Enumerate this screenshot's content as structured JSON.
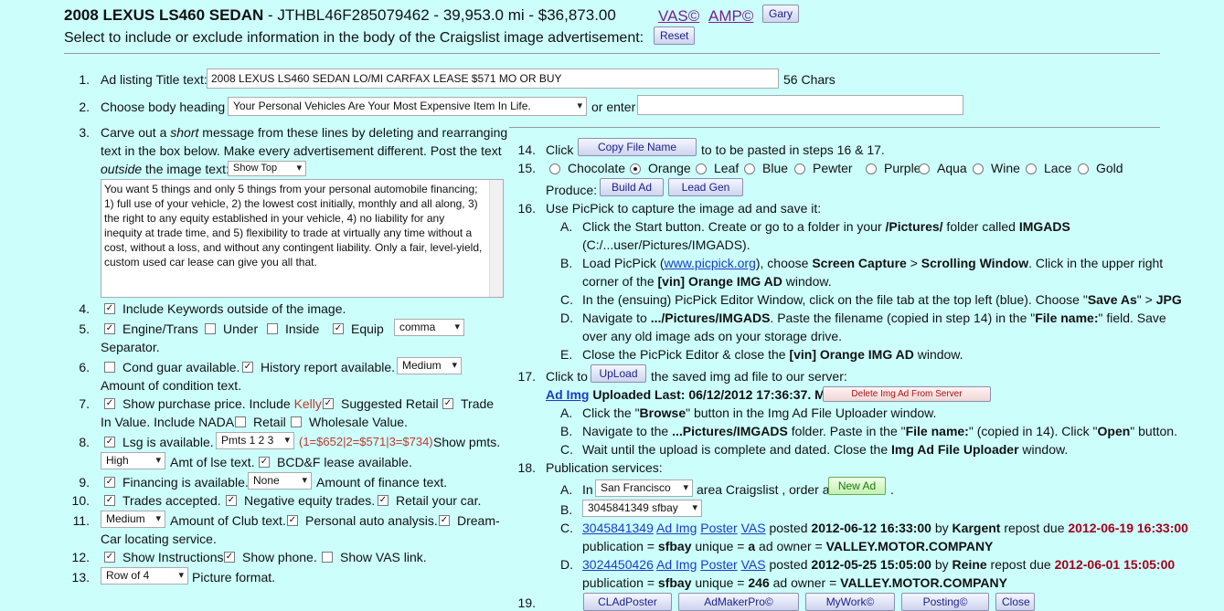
{
  "header": {
    "title_bold": "2008 LEXUS LS460 SEDAN",
    "title_rest": " - JTHBL46F285079462 - 39,953.0 mi - $36,873.00",
    "vas_link": "VAS©",
    "amp_link": "AMP©",
    "user_button": "Gary",
    "subtitle": "Select to include or exclude information in the body of the Craigslist image advertisement:",
    "reset_button": "Reset"
  },
  "step1": {
    "num": "1.",
    "label": "Ad listing Title text:",
    "value": "2008 LEXUS LS460 SEDAN LO/MI CARFAX LEASE $571 MO OR BUY",
    "chars": "56 Chars"
  },
  "step2": {
    "num": "2.",
    "label": "Choose body heading",
    "selected": "Your Personal Vehicles Are Your Most Expensive Item In Life.",
    "or_enter": "or enter",
    "custom_value": ""
  },
  "step3": {
    "num": "3.",
    "line1a": "Carve out a ",
    "line1em": "short",
    "line1b": " message from these lines by deleting and rearranging",
    "line2": "text in the box below. Make every advertisement different. Post the text",
    "line3em": "outside",
    "line3b": " the image text:",
    "show_select": "Show Top",
    "textarea": "You want 5 things and only 5 things from your personal automobile financing; 1) full use of your vehicle, 2) the lowest cost initially, monthly and all along, 3) the right to any equity established in your vehicle, 4) no liability for any inequity at trade time, and 5) flexibility to trade at virtually any time without a cost, without a loss, and without any contingent liability. Only a fair, level-yield, custom used car lease can give you all that."
  },
  "step4": {
    "num": "4.",
    "label": "Include Keywords outside of the image."
  },
  "step5": {
    "num": "5.",
    "engine": "Engine/Trans",
    "under": "Under",
    "inside": "Inside",
    "equip": "Equip",
    "separator_select": "comma",
    "separator_label": "Separator."
  },
  "step6": {
    "num": "6.",
    "cond": "Cond guar available.",
    "history": "History report available.",
    "amount_select": "Medium",
    "amount_label": "Amount of condition text."
  },
  "step7": {
    "num": "7.",
    "show": "Show purchase price. Include ",
    "kelly": "Kelly",
    "suggested": "Suggested Retail",
    "trade": "Trade",
    "line2": "In Value. Include NADA",
    "retail": "Retail",
    "wholesale": "Wholesale Value."
  },
  "step8": {
    "num": "8.",
    "lsg": "Lsg is available.",
    "pmts_select": "Pmts 1 2 3",
    "pmts_values": "(1=$652|2=$571|3=$734)",
    "show_pmts": "Show pmts.",
    "amt_select": "High",
    "amt_label": "Amt of lse text.",
    "bcd": "BCD&F lease available."
  },
  "step9": {
    "num": "9.",
    "label": "Financing is available.",
    "select": "None",
    "amount": "Amount of finance text."
  },
  "step10": {
    "num": "10.",
    "trades": "Trades accepted.",
    "negative": "Negative equity trades.",
    "retail_car": "Retail your car."
  },
  "step11": {
    "num": "11.",
    "select": "Medium",
    "club": "Amount of Club text.",
    "personal": "Personal auto analysis.",
    "dream1": "Dream-",
    "dream2": "Car locating service."
  },
  "step12": {
    "num": "12.",
    "instructions": "Show Instructions",
    "phone": "Show phone.",
    "vas": "Show VAS link."
  },
  "step13": {
    "num": "13.",
    "select": "Row of 4",
    "label": "Picture format."
  },
  "step14": {
    "num": "14.",
    "click": "Click",
    "button": "Copy File Name",
    "rest": "to to be pasted in steps 16 & 17."
  },
  "step15": {
    "num": "15.",
    "colors": [
      "Chocolate",
      "Orange",
      "Leaf",
      "Blue",
      "Pewter",
      "Purple",
      "Aqua",
      "Wine",
      "Lace",
      "Gold"
    ],
    "produce": "Produce:",
    "build": "Build Ad",
    "lead": "Lead Gen"
  },
  "step16": {
    "num": "16.",
    "intro": "Use PicPick to capture the image ad and save it:",
    "a1": "Click the Start button. Create or go to a folder in your ",
    "a1b": "/Pictures/",
    "a1c": " folder called ",
    "a1d": "IMGADS",
    "a2": "(C:/...user/Pictures/IMGADS).",
    "b1": "Load PicPick (",
    "b1link": "www.picpick.org",
    "b1c": "), choose ",
    "b1d": "Screen Capture",
    "b1e": " > ",
    "b1f": "Scrolling Window",
    "b1g": ". Click in the upper right",
    "b2": "corner of the ",
    "b2b": "[vin] Orange IMG AD",
    "b2c": " window.",
    "c1": "In the (ensuing) PicPick Editor Window, click on the file tab at the top left (blue). Choose \"",
    "c1b": "Save As",
    "c1c": "\" > ",
    "c1d": "JPG",
    "d1": "Navigate to ",
    "d1b": ".../Pictures/IMGADS",
    "d1c": ". Paste the filename (copied in step 14) in the \"",
    "d1d": "File name:",
    "d1e": "\" field. Save",
    "d2": "over any old image ads on your storage drive.",
    "e1": "Close the PicPick Editor & close the ",
    "e1b": "[vin] Orange IMG AD",
    "e1c": " window."
  },
  "step17": {
    "num": "17.",
    "click_to": "Click to",
    "upload": "UpLoad",
    "rest": "the saved img ad file to our server:",
    "ad_img": "Ad Img",
    "uploaded": "Uploaded Last: 06/12/2012 17:36:37. MTZ",
    "delete": "Delete Img Ad From Server",
    "a1": "Click the \"",
    "a1b": "Browse",
    "a1c": "\" button in the Img Ad File Uploader window.",
    "b1": "Navigate to the ",
    "b1b": "...Pictures/IMGADS",
    "b1c": " folder. Paste in the \"",
    "b1d": "File name:",
    "b1e": "\" (copied in 14). Click \"",
    "b1f": "Open",
    "b1g": "\" button.",
    "c1": "Wait until the upload is complete and dated. Close the ",
    "c1b": "Img Ad File Uploader",
    "c1c": " window."
  },
  "step18": {
    "num": "18.",
    "label": "Publication services:",
    "a_in": "In",
    "city_select": "San Francisco",
    "a_rest": "area Craigslist , order a",
    "new_ad": "New Ad",
    "dot": ".",
    "b_select": "3045841349 sfbay",
    "c_id": "3045841349",
    "c_adimg": "Ad Img",
    "c_poster": "Poster",
    "c_vas": "VAS",
    "c_posted": " posted ",
    "c_date": "2012-06-12 16:33:00",
    "c_by": " by ",
    "c_user": "Kargent",
    "c_repost": " repost due ",
    "c_due": "2012-06-19 16:33:00",
    "c_pub": "publication = ",
    "c_pubv": "sfbay",
    "c_unique": " unique = ",
    "c_uniquev": "a",
    "c_owner": " ad owner = ",
    "c_ownerv": "VALLEY.MOTOR.COMPANY",
    "d_id": "3024450426",
    "d_adimg": "Ad Img",
    "d_poster": "Poster",
    "d_vas": "VAS",
    "d_posted": " posted ",
    "d_date": "2012-05-25 15:05:00",
    "d_by": " by ",
    "d_user": "Reine",
    "d_repost": " repost due ",
    "d_due": "2012-06-01 15:05:00",
    "d_pub": "publication = ",
    "d_pubv": "sfbay",
    "d_unique": " unique = ",
    "d_uniquev": "246",
    "d_owner": " ad owner = ",
    "d_ownerv": "VALLEY.MOTOR.COMPANY"
  },
  "step19": {
    "num": "19.",
    "buttons": [
      "CLAdPoster",
      "AdMakerPro©",
      "MyWork©",
      "Posting©",
      "Close"
    ]
  },
  "letters": {
    "A": "A.",
    "B": "B.",
    "C": "C.",
    "D": "D.",
    "E": "E."
  },
  "colors": {
    "background": "#ccfffc",
    "dark_red": "#a3001a",
    "link_blue": "#1a3cc8"
  }
}
